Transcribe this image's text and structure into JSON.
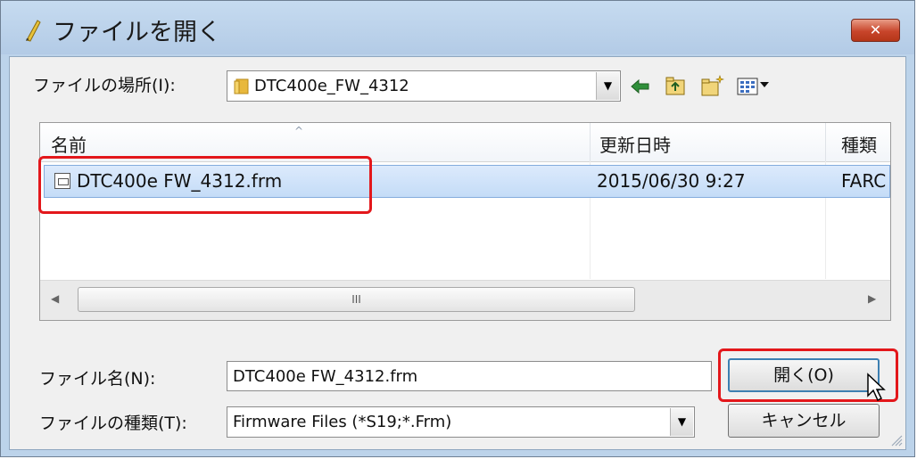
{
  "window": {
    "title": "ファイルを開く",
    "close_label": "✕"
  },
  "location": {
    "label": "ファイルの場所(I):",
    "value": "DTC400e_FW_4312"
  },
  "toolbar": {
    "icons": [
      "back-icon",
      "up-folder-icon",
      "new-folder-icon",
      "view-menu-icon"
    ]
  },
  "file_list": {
    "columns": [
      "名前",
      "更新日時",
      "種類"
    ],
    "rows": [
      {
        "name": "DTC400e FW_4312.frm",
        "modified": "2015/06/30 9:27",
        "type": "FARC"
      }
    ],
    "scroll_thumb_glyph": "III"
  },
  "filename": {
    "label": "ファイル名(N):",
    "value": "DTC400e FW_4312.frm"
  },
  "filetype": {
    "label": "ファイルの種類(T):",
    "value": "Firmware Files (*S19;*.Frm)"
  },
  "buttons": {
    "open": "開く(O)",
    "cancel": "キャンセル"
  },
  "colors": {
    "highlight": "#e3171b",
    "selection": "#c4dcf7",
    "titlebar": "#bcd3ea",
    "close": "#c8452b"
  }
}
